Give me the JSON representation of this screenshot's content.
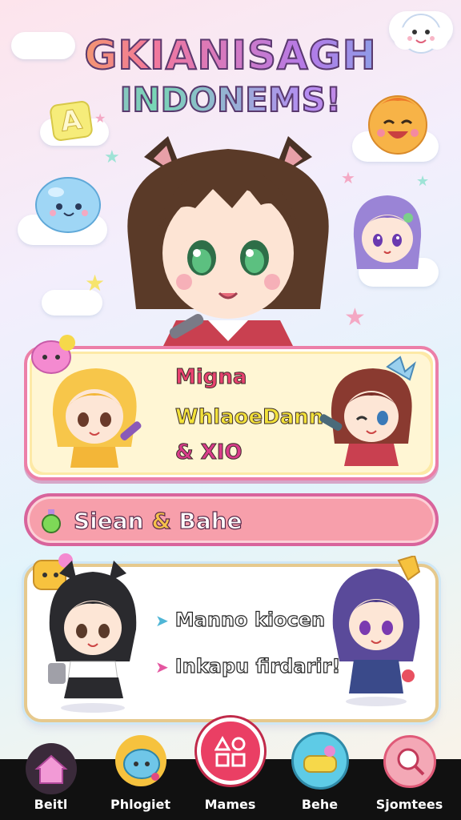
{
  "header": {
    "title_line1": "GKIANISAGH",
    "title_line2": "INDONEMS!"
  },
  "decor": {
    "letter_tile": "A"
  },
  "card_top": {
    "line1": "Migna",
    "line2": "WhlaoeDann",
    "line3": "& XIO",
    "colors": {
      "line1": "#e8426f",
      "line2": "#f3e23a",
      "line3": "#d93c8a"
    }
  },
  "banner": {
    "label_part1": "Siean",
    "label_amp": "&",
    "label_part2": "Bahe",
    "icon": "potion-icon"
  },
  "card_bottom": {
    "line1": "Manno kiocen",
    "line2": "Inkapu firdarir!"
  },
  "nav": {
    "items": [
      {
        "label": "Beitl",
        "icon": "home-icon",
        "color": "#f29ad6"
      },
      {
        "label": "Phlogiet",
        "icon": "slime-icon",
        "color": "#6fc6e8"
      },
      {
        "label": "Mames",
        "icon": "shapes-icon",
        "color": "#ea3f64"
      },
      {
        "label": "Behe",
        "icon": "controller-icon",
        "color": "#5ecbe6"
      },
      {
        "label": "Sjomtees",
        "icon": "search-icon",
        "color": "#f4a8b6"
      }
    ]
  }
}
